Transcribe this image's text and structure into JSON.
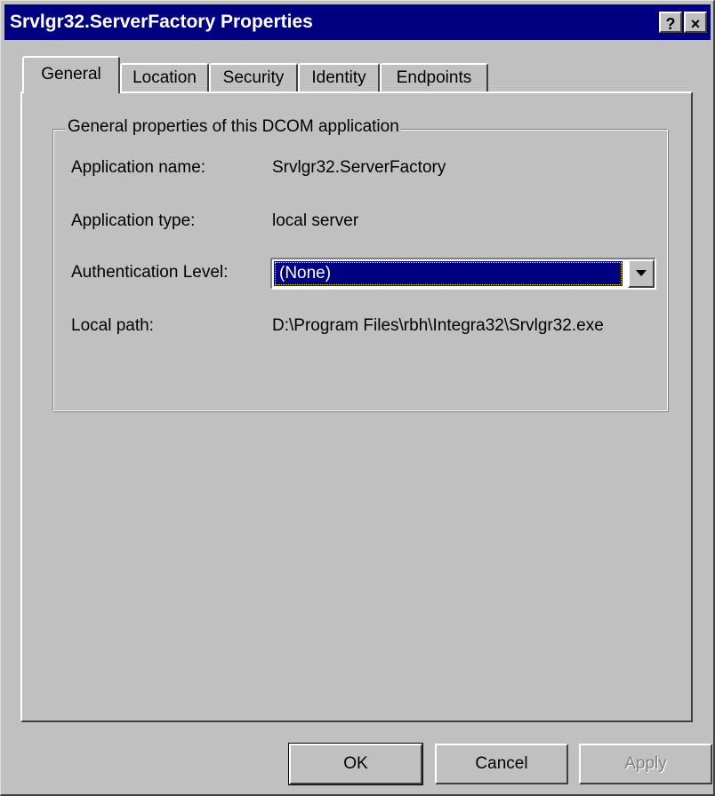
{
  "window": {
    "title": "Srvlgr32.ServerFactory Properties",
    "help_glyph": "?",
    "close_glyph": "×"
  },
  "tabs": [
    {
      "label": "General",
      "active": true
    },
    {
      "label": "Location",
      "active": false
    },
    {
      "label": "Security",
      "active": false
    },
    {
      "label": "Identity",
      "active": false
    },
    {
      "label": "Endpoints",
      "active": false
    }
  ],
  "group": {
    "title": "General properties of this DCOM application",
    "application_name_label": "Application name:",
    "application_name_value": "Srvlgr32.ServerFactory",
    "application_type_label": "Application type:",
    "application_type_value": "local server",
    "authentication_level_label": "Authentication Level:",
    "authentication_level_value": "(None)",
    "local_path_label": "Local path:",
    "local_path_value": "D:\\Program Files\\rbh\\Integra32\\Srvlgr32.exe"
  },
  "buttons": {
    "ok": "OK",
    "cancel": "Cancel",
    "apply": "Apply"
  },
  "colors": {
    "titlebar": "#000080",
    "face": "#c0c0c0",
    "selection": "#000080"
  }
}
